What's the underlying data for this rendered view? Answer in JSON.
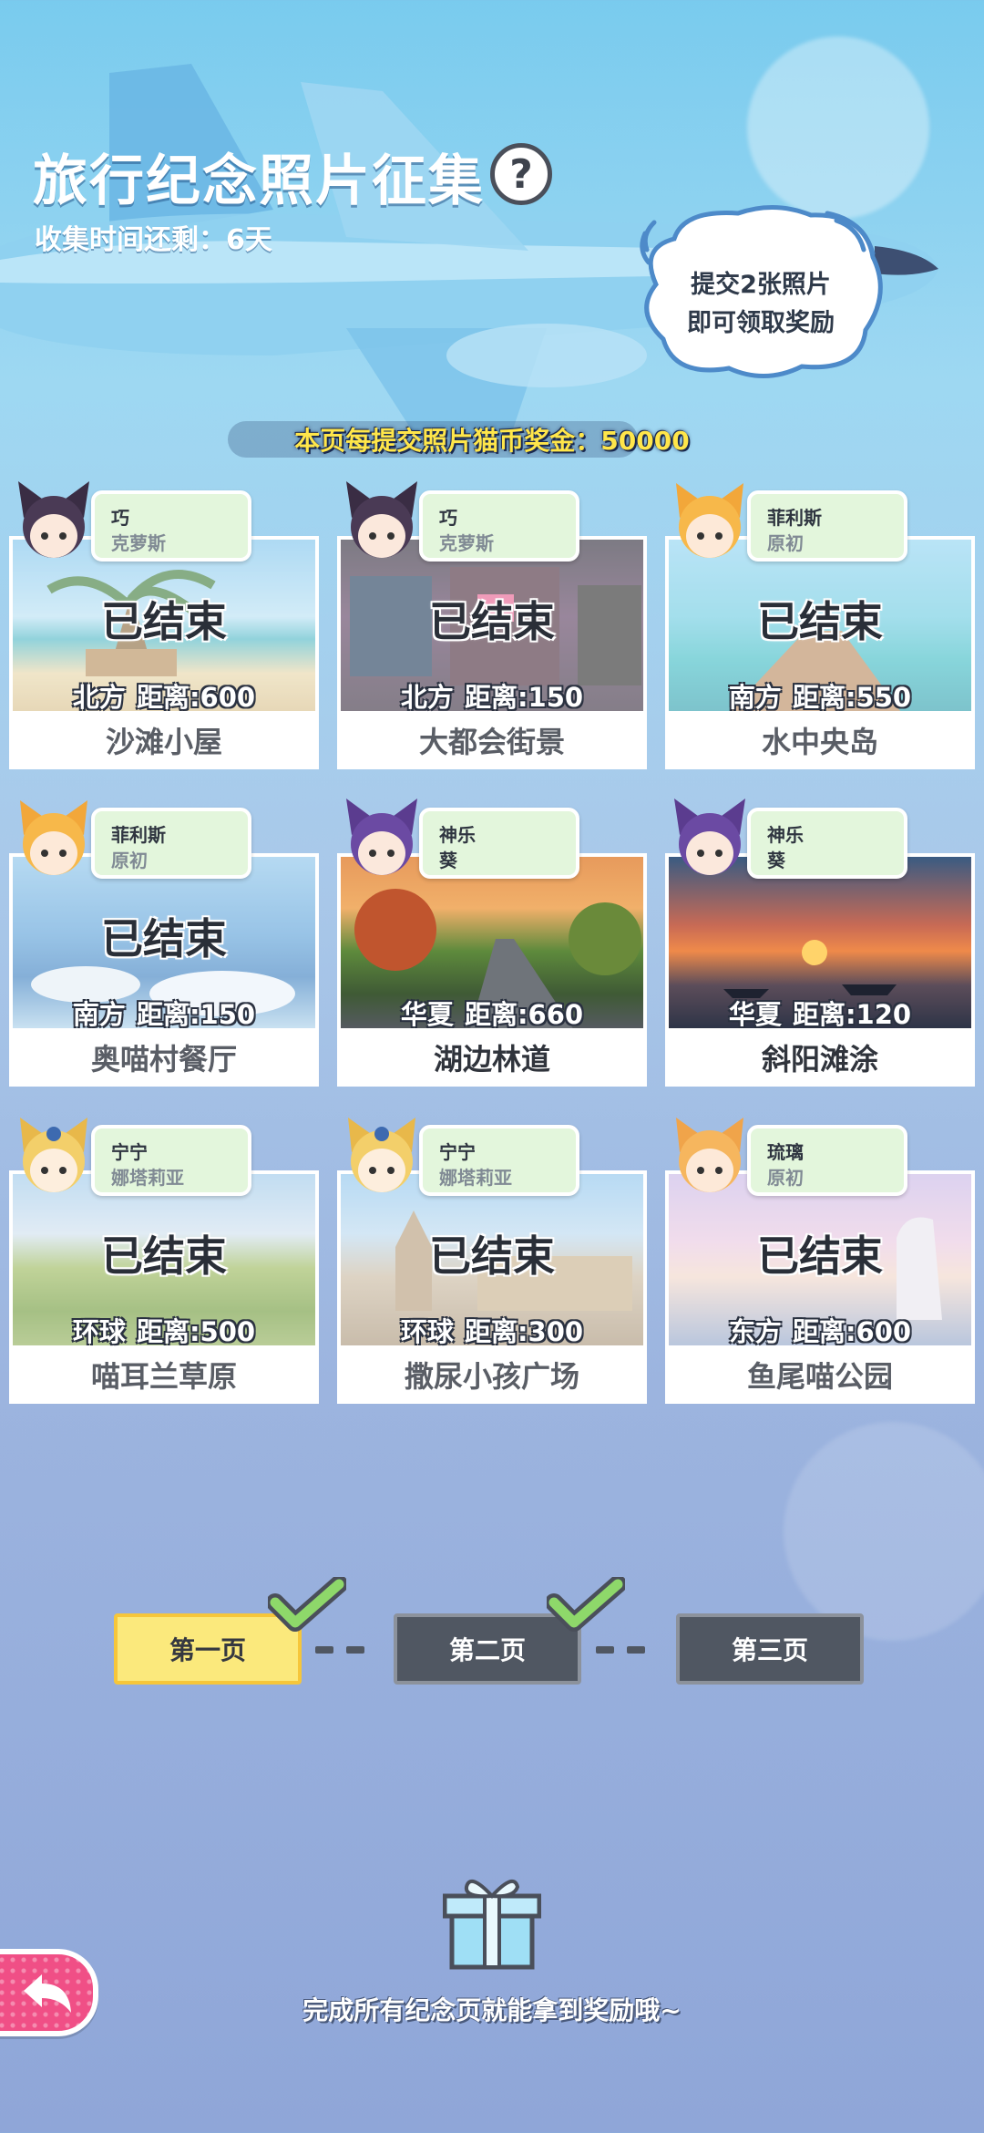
{
  "header": {
    "title": "旅行纪念照片征集",
    "help_label": "?",
    "subtitle": "收集时间还剩：6天"
  },
  "bubble": {
    "line1": "提交2张照片",
    "line2": "即可领取奖励"
  },
  "bonus_text": "本页每提交照片猫币奖金：50000",
  "cards": [
    {
      "name": "沙滩小屋",
      "status": "已结束",
      "direction": "北方",
      "distance": "距离:600",
      "char_name": "巧",
      "char_group": "克萝斯"
    },
    {
      "name": "大都会街景",
      "status": "已结束",
      "direction": "北方",
      "distance": "距离:150",
      "char_name": "巧",
      "char_group": "克萝斯"
    },
    {
      "name": "水中央岛",
      "status": "已结束",
      "direction": "南方",
      "distance": "距离:550",
      "char_name": "菲利斯",
      "char_group": "原初"
    },
    {
      "name": "奥喵村餐厅",
      "status": "已结束",
      "direction": "南方",
      "distance": "距离:150",
      "char_name": "菲利斯",
      "char_group": "原初"
    },
    {
      "name": "湖边林道",
      "status": "",
      "direction": "华夏",
      "distance": "距离:660",
      "char_name": "神乐",
      "char_group": "葵"
    },
    {
      "name": "斜阳滩涂",
      "status": "",
      "direction": "华夏",
      "distance": "距离:120",
      "char_name": "神乐",
      "char_group": "葵"
    },
    {
      "name": "喵耳兰草原",
      "status": "已结束",
      "direction": "环球",
      "distance": "距离:500",
      "char_name": "宁宁",
      "char_group": "娜塔莉亚"
    },
    {
      "name": "撒尿小孩广场",
      "status": "已结束",
      "direction": "环球",
      "distance": "距离:300",
      "char_name": "宁宁",
      "char_group": "娜塔莉亚"
    },
    {
      "name": "鱼尾喵公园",
      "status": "已结束",
      "direction": "东方",
      "distance": "距离:600",
      "char_name": "琉璃",
      "char_group": "原初"
    }
  ],
  "pager": {
    "pages": [
      {
        "label": "第一页",
        "active": true,
        "completed": true
      },
      {
        "label": "第二页",
        "active": false,
        "completed": true
      },
      {
        "label": "第三页",
        "active": false,
        "completed": false
      }
    ]
  },
  "reward": {
    "text": "完成所有纪念页就能拿到奖励哦~"
  },
  "colors": {
    "active_page": "#fbe97c",
    "inactive_page": "#505762",
    "tag_bg": "#e3f6dc",
    "bonus_text": "#ffe64a",
    "back_button": "#f04f86",
    "check": "#8ed86a"
  },
  "icons": [
    "help-icon",
    "gift-icon",
    "back-arrow-icon",
    "checkmark-icon"
  ]
}
